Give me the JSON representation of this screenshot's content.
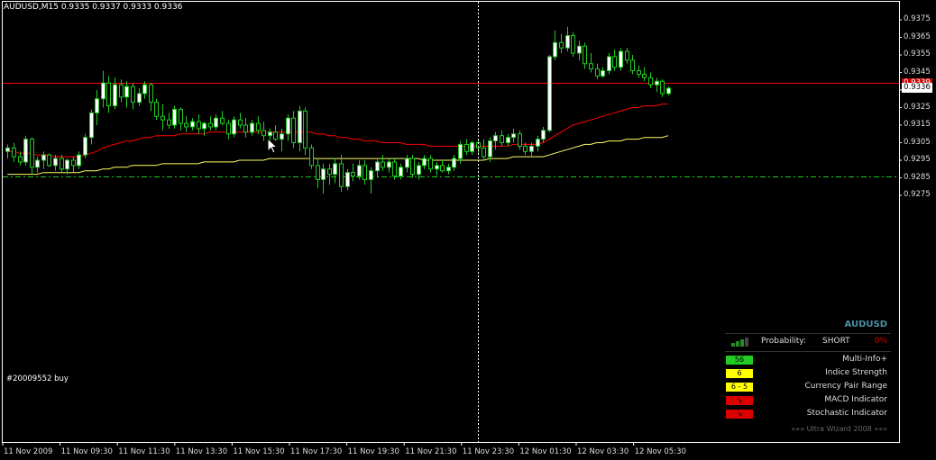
{
  "header": {
    "title": "AUDUSD,M15  0.9335 0.9337 0.9333 0.9336"
  },
  "order": {
    "label": "#20009552 buy"
  },
  "price_axis": {
    "labels": [
      "0.9375",
      "0.9365",
      "0.9355",
      "0.9345",
      "0.9335",
      "0.9325",
      "0.9315",
      "0.9305",
      "0.9295",
      "0.9285",
      "0.9275"
    ],
    "red_line_badge": "0.9339",
    "current_badge": "0.9336"
  },
  "time_axis": {
    "labels": [
      "11 Nov 2009",
      "11 Nov 09:30",
      "11 Nov 11:30",
      "11 Nov 13:30",
      "11 Nov 15:30",
      "11 Nov 17:30",
      "11 Nov 19:30",
      "11 Nov 21:30",
      "11 Nov 23:30",
      "12 Nov 01:30",
      "12 Nov 03:30",
      "12 Nov 05:30"
    ]
  },
  "panel": {
    "title": "AUDUSD",
    "probability_label": "Probability:",
    "probability_direction": "SHORT",
    "probability_pct": "0%",
    "indicators": [
      {
        "value": "56",
        "name": "Multi-Info+",
        "color": "#22cc22"
      },
      {
        "value": "6",
        "name": "Indice Strength",
        "color": "#ffff00"
      },
      {
        "value": "6 - 5",
        "name": "Currency Pair Range",
        "color": "#ffff00"
      },
      {
        "value": "↘",
        "name": "MACD Indicator",
        "color": "#dd0000"
      },
      {
        "value": "↘",
        "name": "Stochastic Indicator",
        "color": "#dd0000"
      }
    ],
    "footer": "»»» Ultra Wizard 2008 «««"
  },
  "colors": {
    "bull_body": "#ffffff",
    "bear_body": "#000000",
    "wick": "#22cc22",
    "red_ma": "#ff0000",
    "yellow_ma": "#ffff66",
    "hline_red": "#ff0000",
    "order_line": "#22cc22"
  },
  "chart_data": {
    "type": "candlestick",
    "title": "AUDUSD,M15",
    "ylim": [
      0.927,
      0.938
    ],
    "levels": {
      "red_line": 0.9339,
      "order_price": 0.92856,
      "current": 0.9336
    },
    "x": [
      "11 Nov 2009",
      "11 Nov 09:30",
      "11 Nov 11:30",
      "11 Nov 13:30",
      "11 Nov 15:30",
      "11 Nov 17:30",
      "11 Nov 19:30",
      "11 Nov 21:30",
      "11 Nov 23:30",
      "12 Nov 01:30",
      "12 Nov 03:30",
      "12 Nov 05:30"
    ],
    "candles": [
      [
        0.93,
        0.9304,
        0.9296,
        0.9302
      ],
      [
        0.9302,
        0.9305,
        0.9294,
        0.9297
      ],
      [
        0.9297,
        0.93,
        0.9292,
        0.9294
      ],
      [
        0.9294,
        0.9309,
        0.9292,
        0.9307
      ],
      [
        0.9307,
        0.9308,
        0.9287,
        0.9291
      ],
      [
        0.9291,
        0.9297,
        0.9288,
        0.9295
      ],
      [
        0.9295,
        0.93,
        0.929,
        0.9298
      ],
      [
        0.9298,
        0.9299,
        0.9291,
        0.9292
      ],
      [
        0.9292,
        0.9298,
        0.9289,
        0.9296
      ],
      [
        0.9296,
        0.9298,
        0.9288,
        0.929
      ],
      [
        0.929,
        0.9296,
        0.9287,
        0.9295
      ],
      [
        0.9295,
        0.9297,
        0.9288,
        0.9292
      ],
      [
        0.9292,
        0.93,
        0.929,
        0.9298
      ],
      [
        0.9298,
        0.931,
        0.9296,
        0.9308
      ],
      [
        0.9308,
        0.9324,
        0.9304,
        0.9322
      ],
      [
        0.9322,
        0.9335,
        0.9315,
        0.933
      ],
      [
        0.933,
        0.9346,
        0.9325,
        0.9339
      ],
      [
        0.9339,
        0.9343,
        0.9322,
        0.9326
      ],
      [
        0.9326,
        0.9342,
        0.9324,
        0.9338
      ],
      [
        0.9338,
        0.9341,
        0.9328,
        0.9331
      ],
      [
        0.9331,
        0.934,
        0.9325,
        0.9337
      ],
      [
        0.9337,
        0.9339,
        0.9324,
        0.9328
      ],
      [
        0.9328,
        0.9336,
        0.9326,
        0.9333
      ],
      [
        0.9333,
        0.934,
        0.933,
        0.9338
      ],
      [
        0.9338,
        0.9339,
        0.9323,
        0.9328
      ],
      [
        0.9328,
        0.933,
        0.9318,
        0.932
      ],
      [
        0.932,
        0.9327,
        0.9312,
        0.9318
      ],
      [
        0.9318,
        0.9322,
        0.9313,
        0.9315
      ],
      [
        0.9315,
        0.9326,
        0.9313,
        0.9324
      ],
      [
        0.9324,
        0.9325,
        0.9312,
        0.9316
      ],
      [
        0.9316,
        0.932,
        0.9311,
        0.9314
      ],
      [
        0.9314,
        0.9319,
        0.9312,
        0.9317
      ],
      [
        0.9317,
        0.9321,
        0.931,
        0.9313
      ],
      [
        0.9313,
        0.9317,
        0.9309,
        0.9316
      ],
      [
        0.9316,
        0.932,
        0.9312,
        0.9314
      ],
      [
        0.9314,
        0.9321,
        0.9312,
        0.9319
      ],
      [
        0.9319,
        0.9323,
        0.9315,
        0.9316
      ],
      [
        0.9316,
        0.9318,
        0.9307,
        0.931
      ],
      [
        0.931,
        0.932,
        0.9308,
        0.9318
      ],
      [
        0.9318,
        0.9322,
        0.9313,
        0.9315
      ],
      [
        0.9315,
        0.9319,
        0.9308,
        0.9311
      ],
      [
        0.9311,
        0.9318,
        0.9309,
        0.9316
      ],
      [
        0.9316,
        0.932,
        0.931,
        0.9312
      ],
      [
        0.9312,
        0.9317,
        0.9306,
        0.9309
      ],
      [
        0.9309,
        0.9313,
        0.9305,
        0.9311
      ],
      [
        0.9311,
        0.9315,
        0.9306,
        0.9307
      ],
      [
        0.9307,
        0.9313,
        0.93,
        0.931
      ],
      [
        0.931,
        0.9321,
        0.9306,
        0.9319
      ],
      [
        0.9319,
        0.9323,
        0.9302,
        0.9305
      ],
      [
        0.9305,
        0.9326,
        0.93,
        0.9323
      ],
      [
        0.9323,
        0.9325,
        0.9298,
        0.9302
      ],
      [
        0.9302,
        0.9304,
        0.929,
        0.9292
      ],
      [
        0.9292,
        0.9296,
        0.9279,
        0.9284
      ],
      [
        0.9284,
        0.9293,
        0.9276,
        0.929
      ],
      [
        0.929,
        0.9293,
        0.9281,
        0.9287
      ],
      [
        0.9287,
        0.9296,
        0.9282,
        0.9293
      ],
      [
        0.9293,
        0.9298,
        0.9277,
        0.928
      ],
      [
        0.928,
        0.929,
        0.9278,
        0.9288
      ],
      [
        0.9288,
        0.9293,
        0.9283,
        0.9286
      ],
      [
        0.9286,
        0.9295,
        0.9284,
        0.9292
      ],
      [
        0.9292,
        0.9295,
        0.9281,
        0.9284
      ],
      [
        0.9284,
        0.9291,
        0.9276,
        0.9289
      ],
      [
        0.9289,
        0.9296,
        0.9285,
        0.9294
      ],
      [
        0.9294,
        0.9298,
        0.9289,
        0.9291
      ],
      [
        0.9291,
        0.9296,
        0.9288,
        0.9294
      ],
      [
        0.9294,
        0.9296,
        0.9284,
        0.9286
      ],
      [
        0.9286,
        0.9293,
        0.9284,
        0.9291
      ],
      [
        0.9291,
        0.9298,
        0.9288,
        0.9296
      ],
      [
        0.9296,
        0.9298,
        0.9285,
        0.9287
      ],
      [
        0.9287,
        0.9294,
        0.9284,
        0.9292
      ],
      [
        0.9292,
        0.9298,
        0.929,
        0.9296
      ],
      [
        0.9296,
        0.9298,
        0.9288,
        0.929
      ],
      [
        0.929,
        0.9294,
        0.9286,
        0.9292
      ],
      [
        0.9292,
        0.9295,
        0.9288,
        0.9289
      ],
      [
        0.9289,
        0.9293,
        0.9287,
        0.9291
      ],
      [
        0.9291,
        0.9298,
        0.9289,
        0.9296
      ],
      [
        0.9296,
        0.9306,
        0.9293,
        0.9304
      ],
      [
        0.9304,
        0.9307,
        0.9298,
        0.93
      ],
      [
        0.93,
        0.9306,
        0.9298,
        0.9305
      ],
      [
        0.9305,
        0.9307,
        0.9299,
        0.9302
      ],
      [
        0.9302,
        0.9307,
        0.9295,
        0.9297
      ],
      [
        0.9297,
        0.9308,
        0.9294,
        0.9306
      ],
      [
        0.9306,
        0.9311,
        0.9301,
        0.9309
      ],
      [
        0.9309,
        0.9312,
        0.9303,
        0.9305
      ],
      [
        0.9305,
        0.931,
        0.9303,
        0.9308
      ],
      [
        0.9308,
        0.9313,
        0.9305,
        0.931
      ],
      [
        0.931,
        0.9312,
        0.9301,
        0.9303
      ],
      [
        0.9303,
        0.9305,
        0.9298,
        0.93
      ],
      [
        0.93,
        0.9305,
        0.9297,
        0.9303
      ],
      [
        0.9303,
        0.9309,
        0.93,
        0.9307
      ],
      [
        0.9307,
        0.9314,
        0.9305,
        0.9312
      ],
      [
        0.9312,
        0.9355,
        0.9311,
        0.9354
      ],
      [
        0.9354,
        0.9369,
        0.9352,
        0.9362
      ],
      [
        0.9362,
        0.9367,
        0.9356,
        0.9359
      ],
      [
        0.9359,
        0.9371,
        0.9357,
        0.9366
      ],
      [
        0.9366,
        0.9368,
        0.9354,
        0.9356
      ],
      [
        0.9356,
        0.9363,
        0.9352,
        0.936
      ],
      [
        0.936,
        0.9362,
        0.9347,
        0.935
      ],
      [
        0.935,
        0.9356,
        0.9345,
        0.9347
      ],
      [
        0.9347,
        0.935,
        0.9341,
        0.9343
      ],
      [
        0.9343,
        0.9348,
        0.9342,
        0.9346
      ],
      [
        0.9346,
        0.9356,
        0.9344,
        0.9354
      ],
      [
        0.9354,
        0.9358,
        0.9346,
        0.9348
      ],
      [
        0.9348,
        0.9359,
        0.9346,
        0.9357
      ],
      [
        0.9357,
        0.9359,
        0.935,
        0.9352
      ],
      [
        0.9352,
        0.9355,
        0.9344,
        0.9346
      ],
      [
        0.9346,
        0.9349,
        0.9342,
        0.9344
      ],
      [
        0.9344,
        0.9348,
        0.934,
        0.9342
      ],
      [
        0.9342,
        0.9345,
        0.9336,
        0.9338
      ],
      [
        0.9338,
        0.9342,
        0.9334,
        0.934
      ],
      [
        0.934,
        0.9341,
        0.9331,
        0.9333
      ],
      [
        0.9333,
        0.9337,
        0.9332,
        0.9336
      ]
    ],
    "ma_red": [
      0.93,
      0.93,
      0.9299,
      0.9299,
      0.9299,
      0.9298,
      0.9298,
      0.9298,
      0.9297,
      0.9297,
      0.9297,
      0.9297,
      0.9297,
      0.9298,
      0.9299,
      0.93,
      0.9302,
      0.9303,
      0.9304,
      0.9305,
      0.9306,
      0.9306,
      0.9307,
      0.9308,
      0.9308,
      0.9309,
      0.9309,
      0.9309,
      0.9309,
      0.931,
      0.931,
      0.931,
      0.931,
      0.931,
      0.9311,
      0.9311,
      0.9311,
      0.9311,
      0.9311,
      0.9311,
      0.9311,
      0.9311,
      0.9311,
      0.9311,
      0.9311,
      0.9311,
      0.9311,
      0.9311,
      0.9311,
      0.9311,
      0.9311,
      0.9311,
      0.931,
      0.931,
      0.9309,
      0.9309,
      0.9308,
      0.9308,
      0.9307,
      0.9307,
      0.9306,
      0.9306,
      0.9306,
      0.9305,
      0.9305,
      0.9305,
      0.9305,
      0.9304,
      0.9304,
      0.9304,
      0.9304,
      0.9303,
      0.9303,
      0.9303,
      0.9303,
      0.9303,
      0.9303,
      0.9303,
      0.9303,
      0.9303,
      0.9303,
      0.9303,
      0.9303,
      0.9303,
      0.9303,
      0.9304,
      0.9304,
      0.9304,
      0.9304,
      0.9304,
      0.9305,
      0.9307,
      0.9309,
      0.9311,
      0.9313,
      0.9315,
      0.9316,
      0.9317,
      0.9318,
      0.9319,
      0.932,
      0.9321,
      0.9322,
      0.9323,
      0.9324,
      0.9325,
      0.9325,
      0.9326,
      0.9326,
      0.9326,
      0.9327,
      0.9327
    ],
    "ma_yellow": [
      0.9287,
      0.9287,
      0.9287,
      0.9287,
      0.9287,
      0.9287,
      0.9288,
      0.9288,
      0.9288,
      0.9288,
      0.9288,
      0.9288,
      0.9288,
      0.9289,
      0.9289,
      0.9289,
      0.929,
      0.929,
      0.9291,
      0.9291,
      0.9291,
      0.9292,
      0.9292,
      0.9292,
      0.9292,
      0.9292,
      0.9293,
      0.9293,
      0.9293,
      0.9293,
      0.9293,
      0.9293,
      0.9293,
      0.9294,
      0.9294,
      0.9294,
      0.9294,
      0.9294,
      0.9294,
      0.9295,
      0.9295,
      0.9295,
      0.9295,
      0.9295,
      0.9296,
      0.9296,
      0.9296,
      0.9296,
      0.9296,
      0.9296,
      0.9296,
      0.9296,
      0.9296,
      0.9296,
      0.9296,
      0.9296,
      0.9296,
      0.9296,
      0.9296,
      0.9296,
      0.9296,
      0.9296,
      0.9296,
      0.9296,
      0.9296,
      0.9296,
      0.9296,
      0.9296,
      0.9296,
      0.9296,
      0.9295,
      0.9295,
      0.9295,
      0.9295,
      0.9295,
      0.9295,
      0.9295,
      0.9295,
      0.9295,
      0.9295,
      0.9295,
      0.9296,
      0.9296,
      0.9296,
      0.9296,
      0.9297,
      0.9297,
      0.9297,
      0.9297,
      0.9297,
      0.9297,
      0.9298,
      0.9299,
      0.93,
      0.9301,
      0.9302,
      0.9303,
      0.9304,
      0.9304,
      0.9305,
      0.9305,
      0.9306,
      0.9306,
      0.9306,
      0.9307,
      0.9307,
      0.9307,
      0.9308,
      0.9308,
      0.9308,
      0.9308,
      0.9309
    ]
  }
}
